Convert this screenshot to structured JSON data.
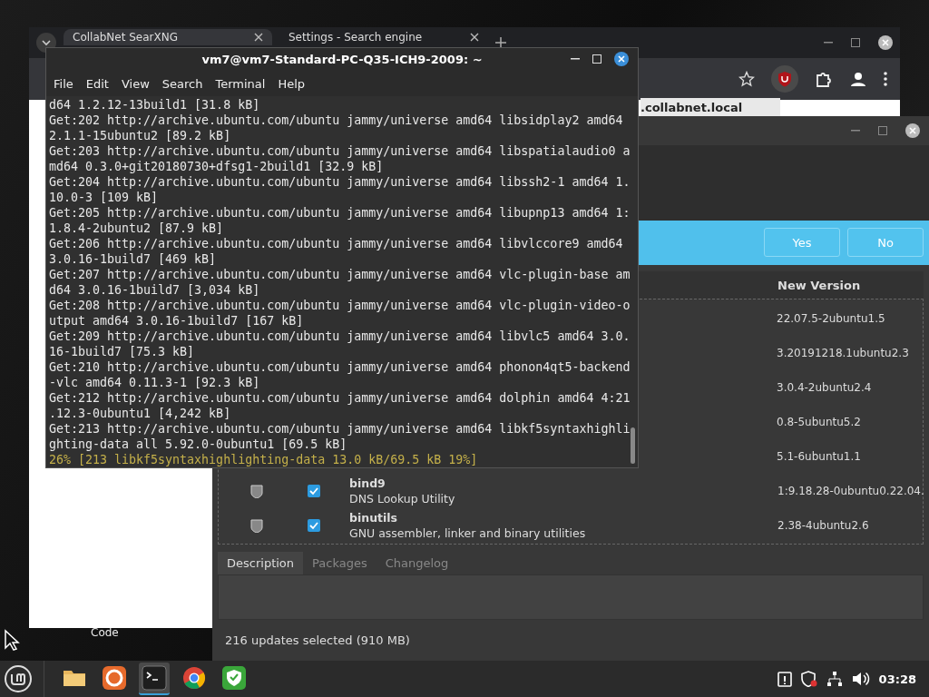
{
  "desktop": {
    "icon_label": "Code"
  },
  "browser": {
    "tabs": [
      {
        "title": "CollabNet SearXNG",
        "selected": true
      },
      {
        "title": "Settings - Search engine",
        "selected": false
      }
    ],
    "page_text": ".collabnet.local"
  },
  "update_manager": {
    "prompt_buttons": [
      "Yes",
      "No"
    ],
    "column": "New Version",
    "packages": [
      {
        "version": "22.07.5-2ubuntu1.5"
      },
      {
        "version": "3.20191218.1ubuntu2.3"
      },
      {
        "version": "3.0.4-2ubuntu2.4"
      },
      {
        "version": "0.8-5ubuntu5.2"
      },
      {
        "version": "5.1-6ubuntu1.1"
      },
      {
        "name": "bind9",
        "description": "DNS Lookup Utility",
        "checked": true,
        "version": "1:9.18.28-0ubuntu0.22.04."
      },
      {
        "name": "binutils",
        "description": "GNU assembler, linker and binary utilities",
        "checked": true,
        "version": "2.38-4ubuntu2.6"
      }
    ],
    "tabs": [
      {
        "label": "Description",
        "selected": true
      },
      {
        "label": "Packages",
        "selected": false
      },
      {
        "label": "Changelog",
        "selected": false
      }
    ],
    "status": "216 updates selected (910 MB)"
  },
  "terminal": {
    "title": "vm7@vm7-Standard-PC-Q35-ICH9-2009: ~",
    "menu": [
      "File",
      "Edit",
      "View",
      "Search",
      "Terminal",
      "Help"
    ],
    "lines": [
      {
        "kind": "output",
        "text": "d64 1.2.12-13build1 [31.8 kB]"
      },
      {
        "kind": "output",
        "text": "Get:202 http://archive.ubuntu.com/ubuntu jammy/universe amd64 libsidplay2 amd64"
      },
      {
        "kind": "output",
        "text": "2.1.1-15ubuntu2 [89.2 kB]"
      },
      {
        "kind": "output",
        "text": "Get:203 http://archive.ubuntu.com/ubuntu jammy/universe amd64 libspatialaudio0 a"
      },
      {
        "kind": "output",
        "text": "md64 0.3.0+git20180730+dfsg1-2build1 [32.9 kB]"
      },
      {
        "kind": "output",
        "text": "Get:204 http://archive.ubuntu.com/ubuntu jammy/universe amd64 libssh2-1 amd64 1."
      },
      {
        "kind": "output",
        "text": "10.0-3 [109 kB]"
      },
      {
        "kind": "output",
        "text": "Get:205 http://archive.ubuntu.com/ubuntu jammy/universe amd64 libupnp13 amd64 1:"
      },
      {
        "kind": "output",
        "text": "1.8.4-2ubuntu2 [87.9 kB]"
      },
      {
        "kind": "output",
        "text": "Get:206 http://archive.ubuntu.com/ubuntu jammy/universe amd64 libvlccore9 amd64"
      },
      {
        "kind": "output",
        "text": "3.0.16-1build7 [469 kB]"
      },
      {
        "kind": "output",
        "text": "Get:207 http://archive.ubuntu.com/ubuntu jammy/universe amd64 vlc-plugin-base am"
      },
      {
        "kind": "output",
        "text": "d64 3.0.16-1build7 [3,034 kB]"
      },
      {
        "kind": "output",
        "text": "Get:208 http://archive.ubuntu.com/ubuntu jammy/universe amd64 vlc-plugin-video-o"
      },
      {
        "kind": "output",
        "text": "utput amd64 3.0.16-1build7 [167 kB]"
      },
      {
        "kind": "output",
        "text": "Get:209 http://archive.ubuntu.com/ubuntu jammy/universe amd64 libvlc5 amd64 3.0."
      },
      {
        "kind": "output",
        "text": "16-1build7 [75.3 kB]"
      },
      {
        "kind": "output",
        "text": "Get:210 http://archive.ubuntu.com/ubuntu jammy/universe amd64 phonon4qt5-backend"
      },
      {
        "kind": "output",
        "text": "-vlc amd64 0.11.3-1 [92.3 kB]"
      },
      {
        "kind": "output",
        "text": "Get:212 http://archive.ubuntu.com/ubuntu jammy/universe amd64 dolphin amd64 4:21"
      },
      {
        "kind": "output",
        "text": ".12.3-0ubuntu1 [4,242 kB]"
      },
      {
        "kind": "output",
        "text": "Get:213 http://archive.ubuntu.com/ubuntu jammy/universe amd64 libkf5syntaxhighli"
      },
      {
        "kind": "output",
        "text": "ghting-data all 5.92.0-0ubuntu1 [69.5 kB]"
      },
      {
        "kind": "progress",
        "text": "26% [213 libkf5syntaxhighlighting-data 13.0 kB/69.5 kB 19%]"
      }
    ]
  },
  "taskbar": {
    "apps": [
      {
        "kind": "files",
        "active": false
      },
      {
        "kind": "firefox",
        "active": false
      },
      {
        "kind": "terminal",
        "active": true
      },
      {
        "kind": "chrome",
        "active": false
      },
      {
        "kind": "shield",
        "active": false
      }
    ],
    "clock": "03:28"
  }
}
